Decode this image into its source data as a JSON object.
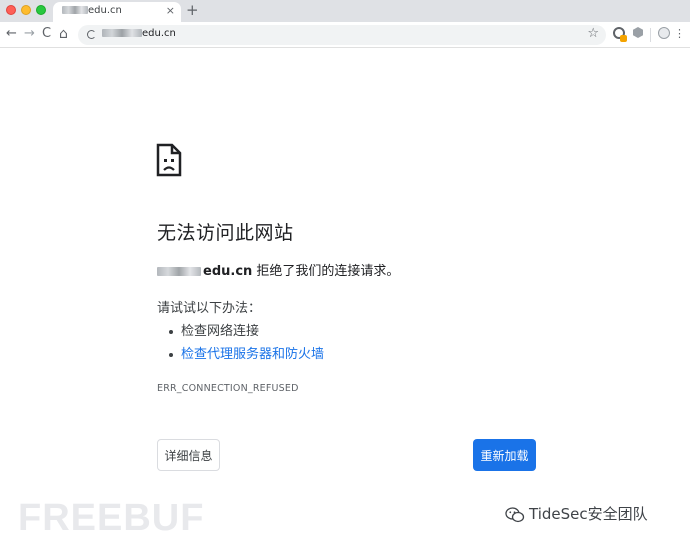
{
  "browser": {
    "tab": {
      "title": "edu.cn",
      "close": "×"
    },
    "new_tab": "+",
    "nav": {
      "back": "←",
      "forward": "→",
      "reload": "C",
      "home": "⌂"
    },
    "address": {
      "url": "edu.cn"
    },
    "bookmark": "☆",
    "menu": "⋮"
  },
  "error": {
    "title": "无法访问此网站",
    "host": "edu.cn",
    "message": "拒绝了我们的连接请求。",
    "try_heading": "请试试以下办法：",
    "suggestions": [
      "检查网络连接",
      "检查代理服务器和防火墙"
    ],
    "code": "ERR_CONNECTION_REFUSED"
  },
  "buttons": {
    "details": "详细信息",
    "reload": "重新加载"
  },
  "watermarks": {
    "left": "FREEBUF",
    "right": "TideSec安全团队"
  },
  "colors": {
    "accent": "#1a73e8",
    "text": "#202124",
    "tabstrip": "#dfe1e5"
  }
}
